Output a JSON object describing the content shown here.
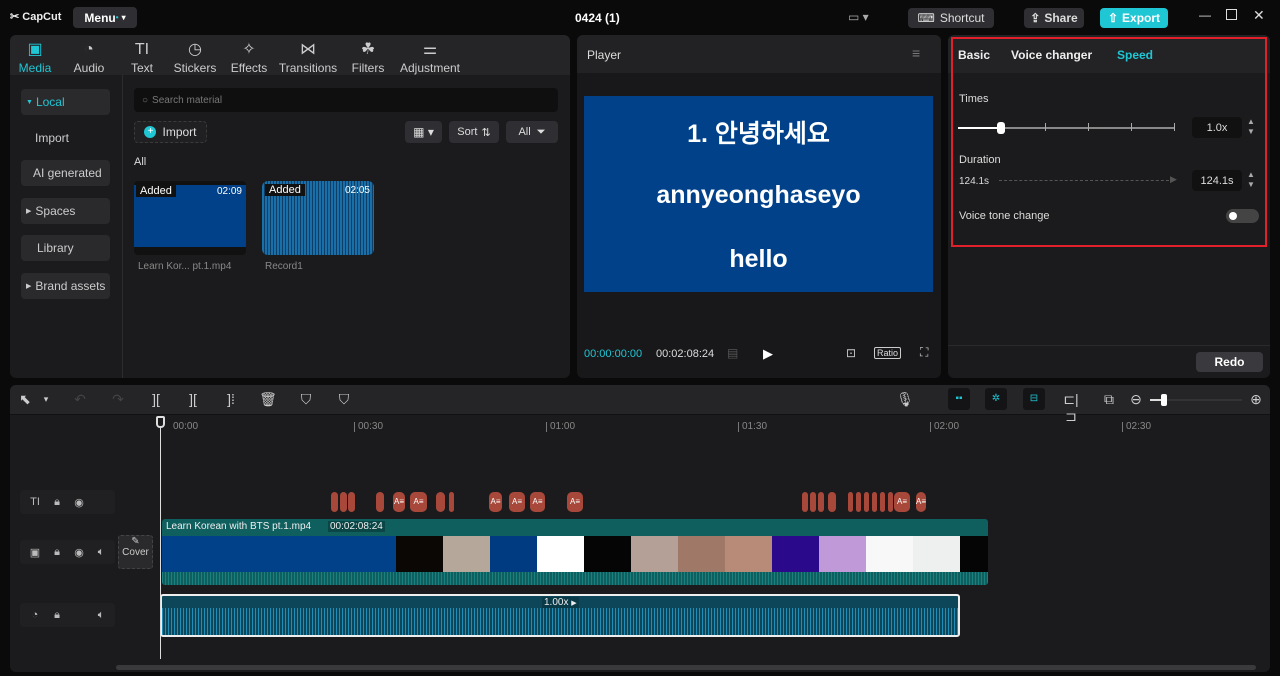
{
  "app": {
    "logo": "CapCut",
    "menu_label": "Menu",
    "project_title": "0424 (1)",
    "shortcut_label": "Shortcut",
    "share_label": "Share",
    "export_label": "Export"
  },
  "media_tabs": [
    {
      "label": "Media",
      "icon": "media-icon"
    },
    {
      "label": "Audio",
      "icon": "audio-icon"
    },
    {
      "label": "Text",
      "icon": "text-icon"
    },
    {
      "label": "Stickers",
      "icon": "stickers-icon"
    },
    {
      "label": "Effects",
      "icon": "effects-icon"
    },
    {
      "label": "Transitions",
      "icon": "transitions-icon"
    },
    {
      "label": "Filters",
      "icon": "filters-icon"
    },
    {
      "label": "Adjustment",
      "icon": "adjustment-icon"
    }
  ],
  "sidebar": {
    "items": [
      {
        "label": "Local"
      },
      {
        "label": "Import"
      },
      {
        "label": "AI generated"
      },
      {
        "label": "Spaces"
      },
      {
        "label": "Library"
      },
      {
        "label": "Brand assets"
      }
    ]
  },
  "media": {
    "search_placeholder": "Search material",
    "import_label": "Import",
    "sort_label": "Sort",
    "filter_label": "All",
    "section_label": "All",
    "items": [
      {
        "badge": "Added",
        "duration": "02:09",
        "name": "Learn Kor... pt.1.mp4"
      },
      {
        "badge": "Added",
        "duration": "02:05",
        "name": "Record1"
      }
    ]
  },
  "player": {
    "title": "Player",
    "lines": [
      "1. 안녕하세요",
      "annyeonghaseyo",
      "hello"
    ],
    "current_time": "00:00:00:00",
    "total_time": "00:02:08:24",
    "ratio_label": "Ratio"
  },
  "props": {
    "tabs": [
      "Basic",
      "Voice changer",
      "Speed"
    ],
    "active_tab": "Speed",
    "times_label": "Times",
    "times_value": "1.0x",
    "speed_fraction": 0.2,
    "duration_label": "Duration",
    "duration_original": "124.1s",
    "duration_value": "124.1s",
    "voice_tone_label": "Voice tone change",
    "voice_tone_on": false,
    "redo_label": "Redo"
  },
  "timeline": {
    "ruler": [
      "00:00",
      "00:30",
      "01:00",
      "01:30",
      "02:00",
      "02:30"
    ],
    "video_clip_name": "Learn Korean with BTS pt.1.mp4",
    "video_clip_duration": "00:02:08:24",
    "audio_speed": "1.00x",
    "cover_label": "Cover",
    "zoom_fraction": 0.15
  },
  "colors": {
    "accent": "#1fc6d4",
    "video_bg": "#00418a",
    "selection_border": "#e0202a",
    "text_clip": "#a8483a"
  }
}
